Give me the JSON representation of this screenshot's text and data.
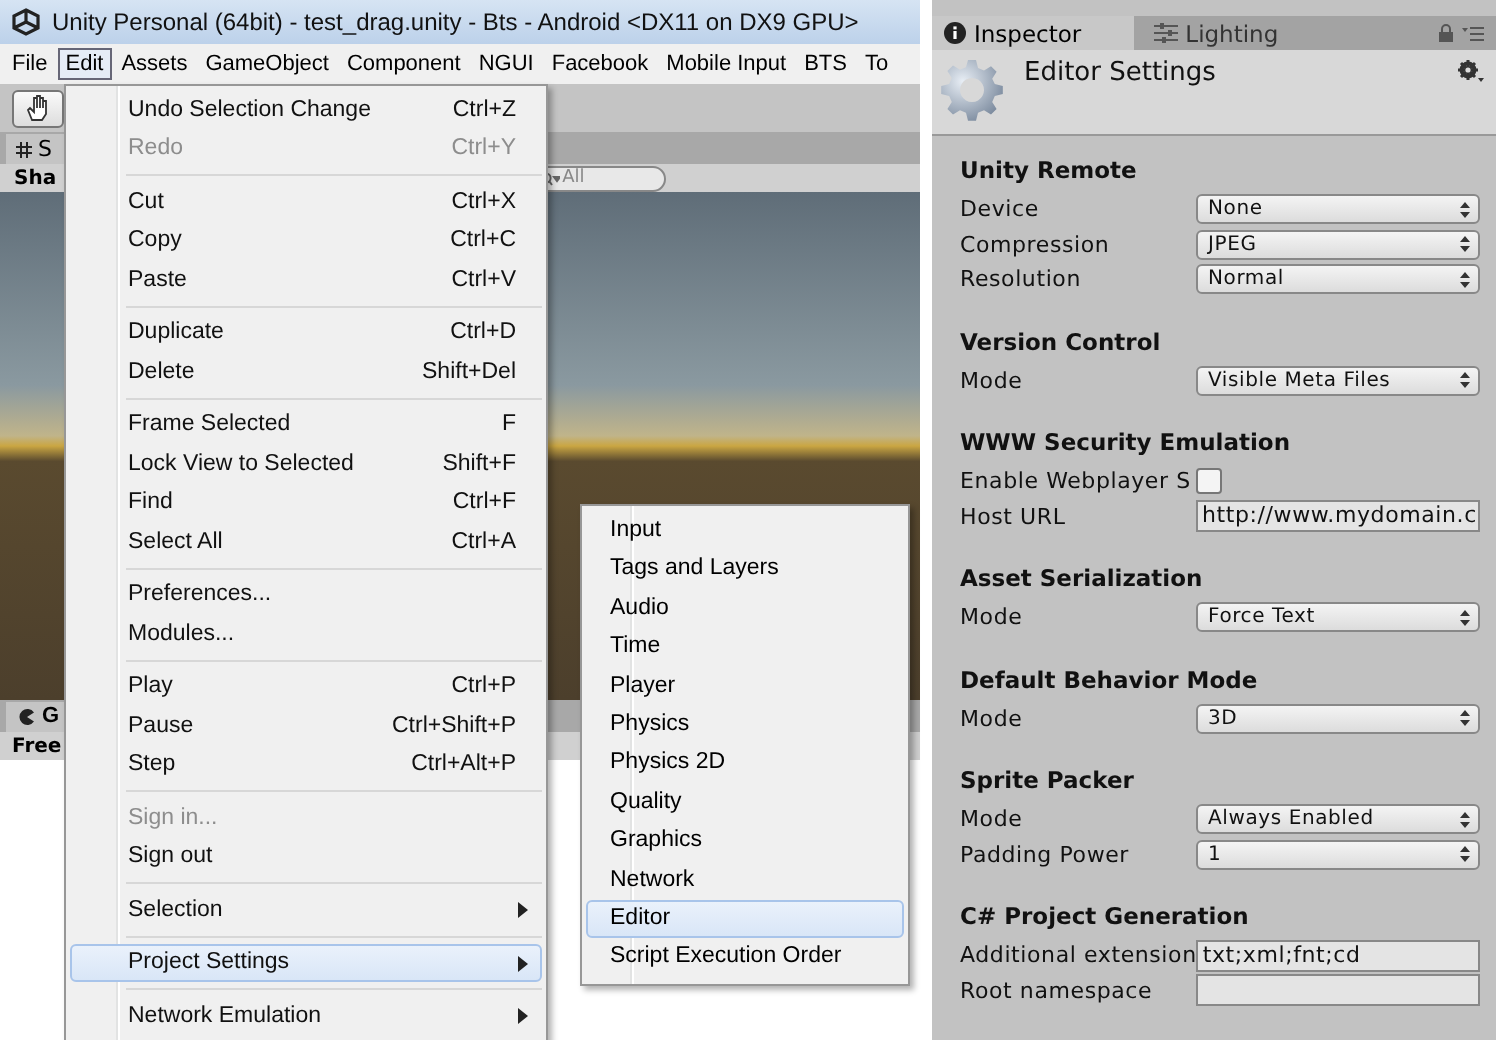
{
  "window": {
    "title": "Unity Personal (64bit) - test_drag.unity - Bts - Android <DX11 on DX9 GPU>"
  },
  "menu_bar": [
    {
      "label": "File",
      "selected": false
    },
    {
      "label": "Edit",
      "selected": true
    },
    {
      "label": "Assets",
      "selected": false
    },
    {
      "label": "GameObject",
      "selected": false
    },
    {
      "label": "Component",
      "selected": false
    },
    {
      "label": "NGUI",
      "selected": false
    },
    {
      "label": "Facebook",
      "selected": false
    },
    {
      "label": "Mobile Input",
      "selected": false
    },
    {
      "label": "BTS",
      "selected": false
    },
    {
      "label": "To",
      "selected": false
    }
  ],
  "scene_panel": {
    "tab": "S",
    "shading": "Sha",
    "search": {
      "placeholder": "All"
    },
    "game_tab": "G",
    "aspect": "Free"
  },
  "edit_menu": {
    "groups": [
      [
        {
          "label": "Undo Selection Change",
          "shortcut": "Ctrl+Z",
          "disabled": false,
          "submenu": false,
          "selected": false
        },
        {
          "label": "Redo",
          "shortcut": "Ctrl+Y",
          "disabled": true,
          "submenu": false,
          "selected": false
        }
      ],
      [
        {
          "label": "Cut",
          "shortcut": "Ctrl+X",
          "disabled": false,
          "submenu": false,
          "selected": false
        },
        {
          "label": "Copy",
          "shortcut": "Ctrl+C",
          "disabled": false,
          "submenu": false,
          "selected": false
        },
        {
          "label": "Paste",
          "shortcut": "Ctrl+V",
          "disabled": false,
          "submenu": false,
          "selected": false
        }
      ],
      [
        {
          "label": "Duplicate",
          "shortcut": "Ctrl+D",
          "disabled": false,
          "submenu": false,
          "selected": false
        },
        {
          "label": "Delete",
          "shortcut": "Shift+Del",
          "disabled": false,
          "submenu": false,
          "selected": false
        }
      ],
      [
        {
          "label": "Frame Selected",
          "shortcut": "F",
          "disabled": false,
          "submenu": false,
          "selected": false
        },
        {
          "label": "Lock View to Selected",
          "shortcut": "Shift+F",
          "disabled": false,
          "submenu": false,
          "selected": false
        },
        {
          "label": "Find",
          "shortcut": "Ctrl+F",
          "disabled": false,
          "submenu": false,
          "selected": false
        },
        {
          "label": "Select All",
          "shortcut": "Ctrl+A",
          "disabled": false,
          "submenu": false,
          "selected": false
        }
      ],
      [
        {
          "label": "Preferences...",
          "disabled": false,
          "submenu": false,
          "selected": false
        },
        {
          "label": "Modules...",
          "disabled": false,
          "submenu": false,
          "selected": false
        }
      ],
      [
        {
          "label": "Play",
          "shortcut": "Ctrl+P",
          "disabled": false,
          "submenu": false,
          "selected": false
        },
        {
          "label": "Pause",
          "shortcut": "Ctrl+Shift+P",
          "disabled": false,
          "submenu": false,
          "selected": false
        },
        {
          "label": "Step",
          "shortcut": "Ctrl+Alt+P",
          "disabled": false,
          "submenu": false,
          "selected": false
        }
      ],
      [
        {
          "label": "Sign in...",
          "disabled": true,
          "submenu": false,
          "selected": false
        },
        {
          "label": "Sign out",
          "disabled": false,
          "submenu": false,
          "selected": false
        }
      ],
      [
        {
          "label": "Selection",
          "disabled": false,
          "submenu": true,
          "selected": false
        }
      ],
      [
        {
          "label": "Project Settings",
          "disabled": false,
          "submenu": true,
          "selected": true
        }
      ],
      [
        {
          "label": "Network Emulation",
          "disabled": false,
          "submenu": true,
          "selected": false
        }
      ]
    ]
  },
  "project_settings_menu": [
    {
      "label": "Input",
      "selected": false
    },
    {
      "label": "Tags and Layers",
      "selected": false
    },
    {
      "label": "Audio",
      "selected": false
    },
    {
      "label": "Time",
      "selected": false
    },
    {
      "label": "Player",
      "selected": false
    },
    {
      "label": "Physics",
      "selected": false
    },
    {
      "label": "Physics 2D",
      "selected": false
    },
    {
      "label": "Quality",
      "selected": false
    },
    {
      "label": "Graphics",
      "selected": false
    },
    {
      "label": "Network",
      "selected": false
    },
    {
      "label": "Editor",
      "selected": true
    },
    {
      "label": "Script Execution Order",
      "selected": false
    }
  ],
  "inspector": {
    "tabs": [
      {
        "label": "Inspector",
        "selected": true
      },
      {
        "label": "Lighting",
        "selected": false
      }
    ],
    "title": "Editor Settings",
    "sections": [
      {
        "heading": "Unity Remote",
        "rows": [
          {
            "kind": "dropdown",
            "label": "Device",
            "value": "None"
          },
          {
            "kind": "dropdown",
            "label": "Compression",
            "value": "JPEG"
          },
          {
            "kind": "dropdown",
            "label": "Resolution",
            "value": "Normal"
          }
        ]
      },
      {
        "heading": "Version Control",
        "rows": [
          {
            "kind": "dropdown",
            "label": "Mode",
            "value": "Visible Meta Files"
          }
        ]
      },
      {
        "heading": "WWW Security Emulation",
        "rows": [
          {
            "kind": "checkbox",
            "label": "Enable Webplayer S",
            "checked": false
          },
          {
            "kind": "text",
            "label": "Host URL",
            "value": "http://www.mydomain.c"
          }
        ]
      },
      {
        "heading": "Asset Serialization",
        "rows": [
          {
            "kind": "dropdown",
            "label": "Mode",
            "value": "Force Text"
          }
        ]
      },
      {
        "heading": "Default Behavior Mode",
        "rows": [
          {
            "kind": "dropdown",
            "label": "Mode",
            "value": "3D"
          }
        ]
      },
      {
        "heading": "Sprite Packer",
        "rows": [
          {
            "kind": "dropdown",
            "label": "Mode",
            "value": "Always Enabled"
          },
          {
            "kind": "dropdown",
            "label": "Padding Power",
            "value": "1"
          }
        ]
      },
      {
        "heading": "C# Project Generation",
        "rows": [
          {
            "kind": "text",
            "label": "Additional extension",
            "value": "txt;xml;fnt;cd"
          },
          {
            "kind": "text",
            "label": "Root namespace",
            "value": ""
          }
        ]
      }
    ]
  }
}
